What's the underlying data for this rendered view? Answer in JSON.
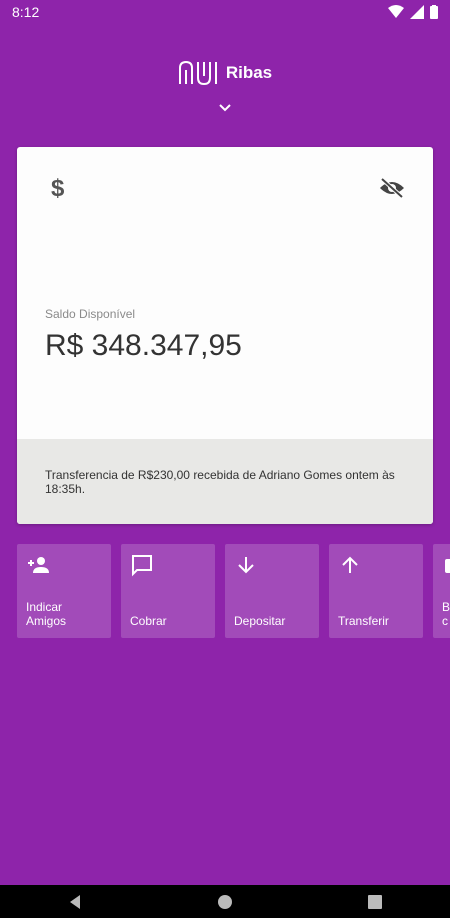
{
  "status_bar": {
    "time": "8:12"
  },
  "header": {
    "user_name": "Ribas"
  },
  "card": {
    "balance_label": "Saldo Disponível",
    "balance_value": "R$ 348.347,95",
    "notification": "Transferencia de R$230,00 recebida de Adriano Gomes ontem às 18:35h."
  },
  "actions": [
    {
      "label": "Indicar\nAmigos",
      "icon": "add-person-icon"
    },
    {
      "label": "Cobrar",
      "icon": "chat-bubble-icon"
    },
    {
      "label": "Depositar",
      "icon": "arrow-down-icon"
    },
    {
      "label": "Transferir",
      "icon": "arrow-up-icon"
    },
    {
      "label": "B\nc",
      "icon": "partial-icon"
    }
  ],
  "colors": {
    "background": "#8e24aa",
    "card": "#fdfdfd",
    "card_footer": "#e8e8e6"
  }
}
